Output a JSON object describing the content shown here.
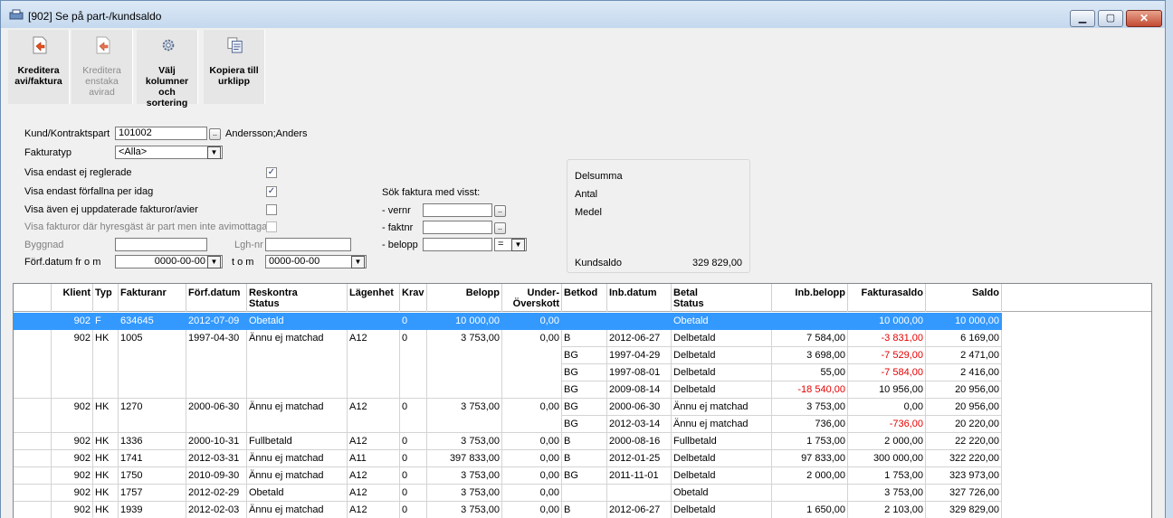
{
  "window": {
    "title": "[902]  Se på part-/kundsaldo",
    "min": "▁",
    "max": "▢",
    "close": "✕"
  },
  "toolbar": [
    {
      "label1": "Kreditera",
      "label2": "avi/faktura",
      "label3": "",
      "icon": "credit-invoice-icon",
      "enabled": true
    },
    {
      "label1": "Kreditera",
      "label2": "enstaka",
      "label3": "avirad",
      "icon": "credit-row-icon",
      "enabled": false
    },
    {
      "label1": "Välj kolumner",
      "label2": "och sortering",
      "label3": "",
      "icon": "gear-icon",
      "enabled": true
    },
    {
      "label1": "Kopiera till",
      "label2": "urklipp",
      "label3": "",
      "icon": "copy-icon",
      "enabled": true
    }
  ],
  "form": {
    "kund_label": "Kund/Kontraktspart",
    "kund_value": "101002",
    "kund_name": "Andersson;Anders",
    "fakturatyp_label": "Fakturatyp",
    "fakturatyp_value": "<Alla>",
    "chk1": "Visa endast ej reglerade",
    "chk2": "Visa endast förfallna per idag",
    "chk3": "Visa även ej uppdaterade fakturor/avier",
    "chk4": "Visa fakturor där hyresgäst är part men inte avimottagare",
    "byggnad_label": "Byggnad",
    "lgh_label": "Lgh-nr",
    "forf_label": "Förf.datum fr o m",
    "forf_from": "0000-00-00",
    "tom_label": "t o m",
    "forf_to": "0000-00-00",
    "sok_label": "Sök faktura med visst:",
    "vernr_label": "- vernr",
    "faktnr_label": "- faktnr",
    "belopp_label": "- belopp",
    "belopp_op": "=",
    "ellipsis": "..",
    "dd": "▼",
    "check": "✓"
  },
  "summary": {
    "delsumma": "Delsumma",
    "antal": "Antal",
    "medel": "Medel",
    "kundsaldo_label": "Kundsaldo",
    "kundsaldo_value": "329 829,00"
  },
  "grid": {
    "headers": [
      {
        "l1": "",
        "l2": "Klient"
      },
      {
        "l1": "",
        "l2": "Typ"
      },
      {
        "l1": "",
        "l2": "Fakturanr"
      },
      {
        "l1": "",
        "l2": "Förf.datum"
      },
      {
        "l1": "Reskontra",
        "l2": "Status"
      },
      {
        "l1": "",
        "l2": "Lägenhet"
      },
      {
        "l1": "",
        "l2": "Krav"
      },
      {
        "l1": "",
        "l2": "Belopp"
      },
      {
        "l1": "Under-",
        "l2": "Överskott"
      },
      {
        "l1": "",
        "l2": "Betkod"
      },
      {
        "l1": "",
        "l2": "Inb.datum"
      },
      {
        "l1": "Betal",
        "l2": "Status"
      },
      {
        "l1": "",
        "l2": "Inb.belopp"
      },
      {
        "l1": "",
        "l2": "Fakturasaldo"
      },
      {
        "l1": "",
        "l2": "Saldo"
      }
    ],
    "rows": [
      [
        "902",
        "F",
        "634645",
        "2012-07-09",
        "Obetald",
        "",
        "0",
        "10 000,00",
        "0,00",
        "",
        "",
        "Obetald",
        "",
        "10 000,00",
        "10 000,00"
      ],
      [
        "902",
        "HK",
        "1005",
        "1997-04-30",
        "Ännu ej matchad",
        "A12",
        "0",
        "3 753,00",
        "0,00",
        "B",
        "2012-06-27",
        "Delbetald",
        "7 584,00",
        "-3 831,00",
        "6 169,00"
      ],
      [
        "",
        "",
        "",
        "",
        "",
        "",
        "",
        "",
        "",
        "BG",
        "1997-04-29",
        "Delbetald",
        "3 698,00",
        "-7 529,00",
        "2 471,00"
      ],
      [
        "",
        "",
        "",
        "",
        "",
        "",
        "",
        "",
        "",
        "BG",
        "1997-08-01",
        "Delbetald",
        "55,00",
        "-7 584,00",
        "2 416,00"
      ],
      [
        "",
        "",
        "",
        "",
        "",
        "",
        "",
        "",
        "",
        "BG",
        "2009-08-14",
        "Delbetald",
        "-18 540,00",
        "10 956,00",
        "20 956,00"
      ],
      [
        "902",
        "HK",
        "1270",
        "2000-06-30",
        "Ännu ej matchad",
        "A12",
        "0",
        "3 753,00",
        "0,00",
        "BG",
        "2000-06-30",
        "Ännu ej matchad",
        "3 753,00",
        "0,00",
        "20 956,00"
      ],
      [
        "",
        "",
        "",
        "",
        "",
        "",
        "",
        "",
        "",
        "BG",
        "2012-03-14",
        "Ännu ej matchad",
        "736,00",
        "-736,00",
        "20 220,00"
      ],
      [
        "902",
        "HK",
        "1336",
        "2000-10-31",
        "Fullbetald",
        "A12",
        "0",
        "3 753,00",
        "0,00",
        "B",
        "2000-08-16",
        "Fullbetald",
        "1 753,00",
        "2 000,00",
        "22 220,00"
      ],
      [
        "902",
        "HK",
        "1741",
        "2012-03-31",
        "Ännu ej matchad",
        "A11",
        "0",
        "397 833,00",
        "0,00",
        "B",
        "2012-01-25",
        "Delbetald",
        "97 833,00",
        "300 000,00",
        "322 220,00"
      ],
      [
        "902",
        "HK",
        "1750",
        "2010-09-30",
        "Ännu ej matchad",
        "A12",
        "0",
        "3 753,00",
        "0,00",
        "BG",
        "2011-11-01",
        "Delbetald",
        "2 000,00",
        "1 753,00",
        "323 973,00"
      ],
      [
        "902",
        "HK",
        "1757",
        "2012-02-29",
        "Obetald",
        "A12",
        "0",
        "3 753,00",
        "0,00",
        "",
        "",
        "Obetald",
        "",
        "3 753,00",
        "327 726,00"
      ],
      [
        "902",
        "HK",
        "1939",
        "2012-02-03",
        "Ännu ej matchad",
        "A12",
        "0",
        "3 753,00",
        "0,00",
        "B",
        "2012-06-27",
        "Delbetald",
        "1 650,00",
        "2 103,00",
        "329 829,00"
      ]
    ]
  }
}
